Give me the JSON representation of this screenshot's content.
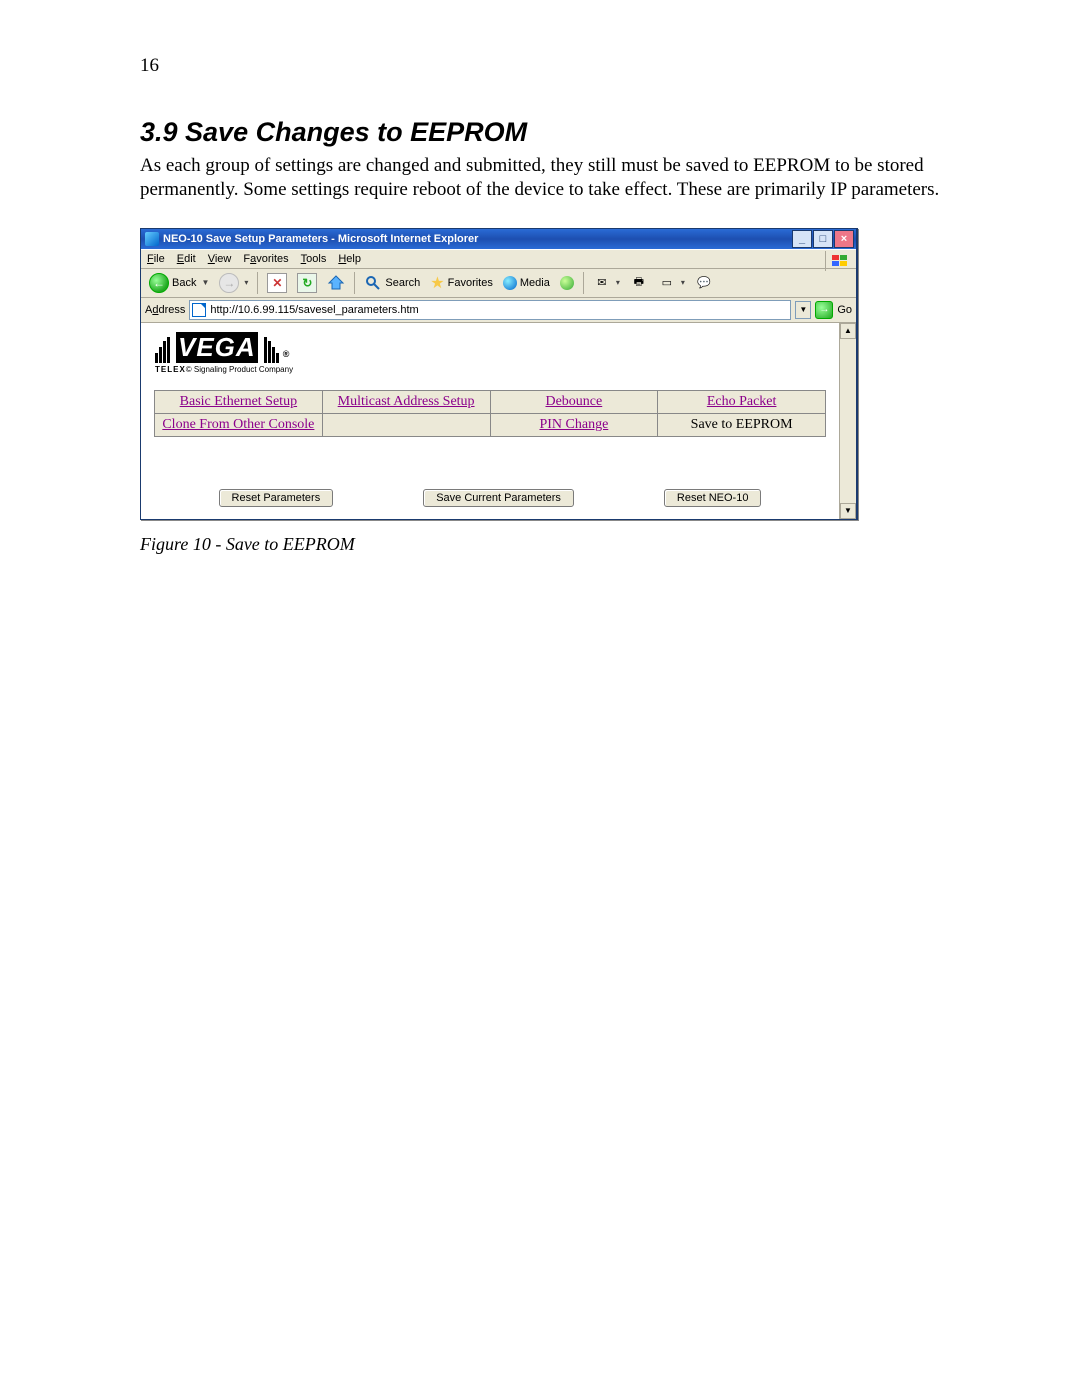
{
  "page_number": "16",
  "heading": "3.9  Save Changes to EEPROM",
  "body_text": "As each group of settings are changed and submitted, they still must be saved to EEPROM to be stored permanently. Some settings require reboot of the device to take effect.  These are primarily IP parameters.",
  "figure_caption": "Figure 10 - Save to EEPROM",
  "ie": {
    "title": "NEO-10 Save Setup Parameters - Microsoft Internet Explorer",
    "menus": {
      "file": "File",
      "edit": "Edit",
      "view": "View",
      "favorites": "Favorites",
      "tools": "Tools",
      "help": "Help"
    },
    "toolbar": {
      "back": "Back",
      "search": "Search",
      "favorites": "Favorites",
      "media": "Media"
    },
    "address_label": "Address",
    "address_value": "http://10.6.99.115/savesel_parameters.htm",
    "go": "Go",
    "logo_brand": "TELEX",
    "logo_sub": "Signaling Product Company",
    "nav": {
      "r1c1": "Basic Ethernet Setup",
      "r1c2": "Multicast Address Setup",
      "r1c3": "Debounce",
      "r1c4": "Echo Packet",
      "r2c1": "Clone From Other Console",
      "r2c2": "",
      "r2c3": "PIN Change",
      "r2c4": "Save to EEPROM"
    },
    "buttons": {
      "reset_params": "Reset Parameters",
      "save_params": "Save Current Parameters",
      "reset_neo": "Reset NEO-10"
    }
  }
}
